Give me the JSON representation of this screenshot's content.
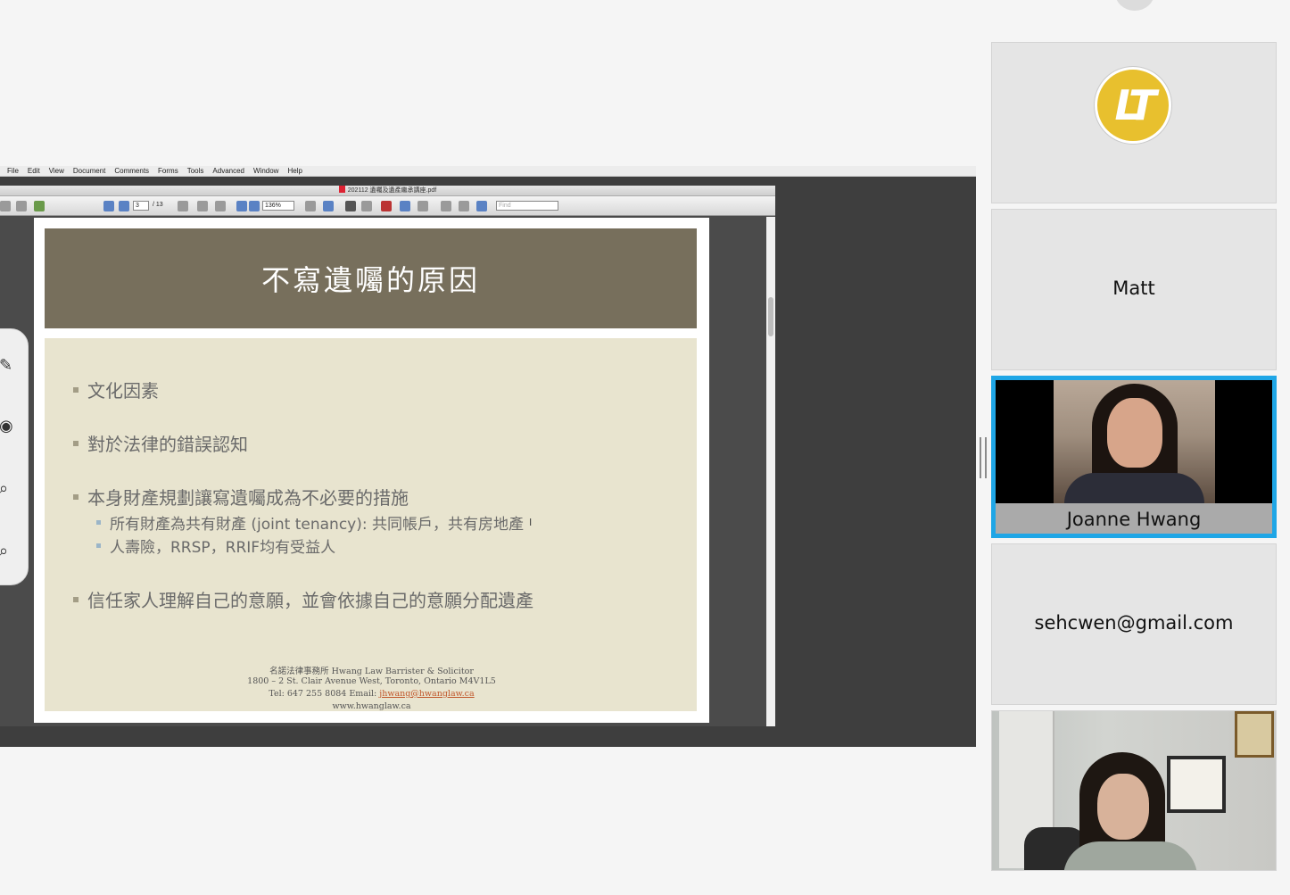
{
  "menubar": {
    "items": [
      "File",
      "Edit",
      "View",
      "Document",
      "Comments",
      "Forms",
      "Tools",
      "Advanced",
      "Window",
      "Help"
    ]
  },
  "acrobat": {
    "title": "202112 遺囑及遺產繼承講座.pdf",
    "page_current": "3",
    "page_total": "/ 13",
    "zoom": "136%",
    "find_placeholder": "Find"
  },
  "slide": {
    "title": "不寫遺囑的原因",
    "bullets": [
      "文化因素",
      "對於法律的錯誤認知",
      "本身財產規劃讓寫遺囑成為不必要的措施",
      "信任家人理解自己的意願，並會依據自己的意願分配遺產"
    ],
    "sub_bullets": [
      "所有財產為共有財產 (joint tenancy): 共同帳戶，共有房地產",
      "人壽險，RRSP，RRIF均有受益人"
    ],
    "footer": {
      "line1": "名諾法律事務所 Hwang Law Barrister & Solicitor",
      "line2": "1800 – 2 St. Clair Avenue West, Toronto, Ontario M4V1L5",
      "line3_prefix": "Tel: 647 255 8084  Email: ",
      "email": "jhwang@hwanglaw.ca",
      "line4": "www.hwanglaw.ca"
    }
  },
  "participants": {
    "logo_text": "LT",
    "tile2_name": "Matt",
    "tile3_name": "Joanne Hwang",
    "tile4_name": "sehcwen@gmail.com"
  },
  "colors": {
    "slide_header": "#776f5c",
    "slide_body": "#e8e4cf",
    "active_speaker_border": "#1fa6e6",
    "logo": "#e8c02e"
  }
}
